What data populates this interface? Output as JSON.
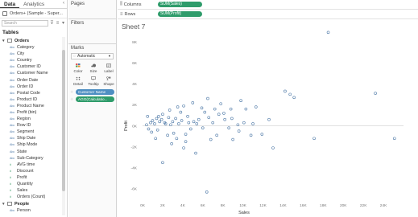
{
  "data_pane": {
    "tabs": [
      "Data",
      "Analytics"
    ],
    "datasource": "Orders+ (Sample - Super...",
    "search_placeholder": "Search",
    "tables_title": "Tables",
    "orders_table": "Orders",
    "dimensions": [
      "Category",
      "City",
      "Country",
      "Customer ID",
      "Customer Name",
      "Order Date",
      "Order ID",
      "Postal Code",
      "Product ID",
      "Product Name",
      "Profit (bin)",
      "Region",
      "Row ID",
      "Segment",
      "Ship Date",
      "Ship Mode",
      "State",
      "Sub-Category"
    ],
    "measures": [
      "AVG time",
      "Discount",
      "Profit",
      "Quantity",
      "Sales",
      "Orders (Count)"
    ],
    "people_table": "People",
    "people_fields": [
      "Person"
    ]
  },
  "shelves": {
    "pages_label": "Pages",
    "filters_label": "Filters",
    "marks_label": "Marks",
    "mark_type": "Automatic",
    "mark_buttons": [
      "Color",
      "Size",
      "Label",
      "Detail",
      "Tooltip",
      "Shape"
    ],
    "mark_pills": [
      "Customer Name",
      "AGG(Calculatio..."
    ]
  },
  "columns_shelf": {
    "label": "Columns",
    "pill": "SUM(Sales)"
  },
  "rows_shelf": {
    "label": "Rows",
    "pill": "SUM(Profit)"
  },
  "sheet_title": "Sheet 7",
  "colors": {
    "mark": "#4e79a7",
    "dimension": "#4e79a7",
    "measure": "#2f9c6b"
  },
  "chart_data": {
    "type": "scatter",
    "xlabel": "Sales",
    "ylabel": "Profit",
    "xlim": [
      0,
      26000
    ],
    "ylim": [
      -7000,
      9000
    ],
    "x_ticks": [
      "0K",
      "2K",
      "4K",
      "6K",
      "8K",
      "10K",
      "12K",
      "14K",
      "16K",
      "18K",
      "20K",
      "22K",
      "24K"
    ],
    "y_ticks": [
      "-6K",
      "-4K",
      "-2K",
      "0K",
      "2K",
      "4K",
      "6K",
      "8K"
    ],
    "points": [
      [
        18500,
        8900
      ],
      [
        14200,
        3300
      ],
      [
        15100,
        2700
      ],
      [
        14700,
        3000
      ],
      [
        25100,
        -1200
      ],
      [
        23200,
        3100
      ],
      [
        6400,
        -6300
      ],
      [
        12600,
        600
      ],
      [
        11300,
        1800
      ],
      [
        10300,
        1600
      ],
      [
        10800,
        -900
      ],
      [
        11900,
        -800
      ],
      [
        17100,
        -1200
      ],
      [
        13000,
        -2100
      ],
      [
        9000,
        -1300
      ],
      [
        8200,
        600
      ],
      [
        7600,
        1100
      ],
      [
        5300,
        -2600
      ],
      [
        2000,
        -3500
      ],
      [
        4100,
        -2100
      ],
      [
        3400,
        -1200
      ],
      [
        6200,
        1300
      ],
      [
        7200,
        1600
      ],
      [
        8100,
        1200
      ],
      [
        2000,
        1100
      ],
      [
        2600,
        800
      ],
      [
        3300,
        700
      ],
      [
        5100,
        400
      ],
      [
        4500,
        900
      ],
      [
        4300,
        -800
      ],
      [
        6000,
        -200
      ],
      [
        5600,
        600
      ],
      [
        3800,
        1300
      ],
      [
        1400,
        700
      ],
      [
        1700,
        400
      ],
      [
        1200,
        200
      ],
      [
        2200,
        300
      ],
      [
        2800,
        100
      ],
      [
        3600,
        200
      ],
      [
        600,
        -300
      ],
      [
        900,
        -600
      ],
      [
        1500,
        -400
      ],
      [
        2500,
        -900
      ],
      [
        3100,
        -700
      ],
      [
        4800,
        -300
      ],
      [
        7000,
        300
      ],
      [
        8600,
        -200
      ],
      [
        9500,
        100
      ],
      [
        6600,
        800
      ],
      [
        5900,
        1700
      ],
      [
        7800,
        2100
      ],
      [
        9800,
        2400
      ],
      [
        4300,
        -1500
      ],
      [
        1300,
        -1200
      ],
      [
        400,
        100
      ],
      [
        800,
        300
      ],
      [
        1000,
        500
      ],
      [
        1900,
        600
      ],
      [
        2300,
        200
      ],
      [
        3000,
        400
      ],
      [
        3900,
        500
      ],
      [
        4600,
        300
      ],
      [
        5400,
        200
      ],
      [
        7400,
        -900
      ],
      [
        8900,
        700
      ],
      [
        9600,
        -500
      ],
      [
        10100,
        300
      ],
      [
        6800,
        -1300
      ],
      [
        2700,
        1500
      ],
      [
        3500,
        1800
      ],
      [
        4100,
        1900
      ],
      [
        5000,
        2200
      ],
      [
        6500,
        2600
      ],
      [
        8800,
        1600
      ],
      [
        11000,
        200
      ],
      [
        2900,
        -1700
      ],
      [
        500,
        900
      ],
      [
        1600,
        900
      ]
    ]
  }
}
